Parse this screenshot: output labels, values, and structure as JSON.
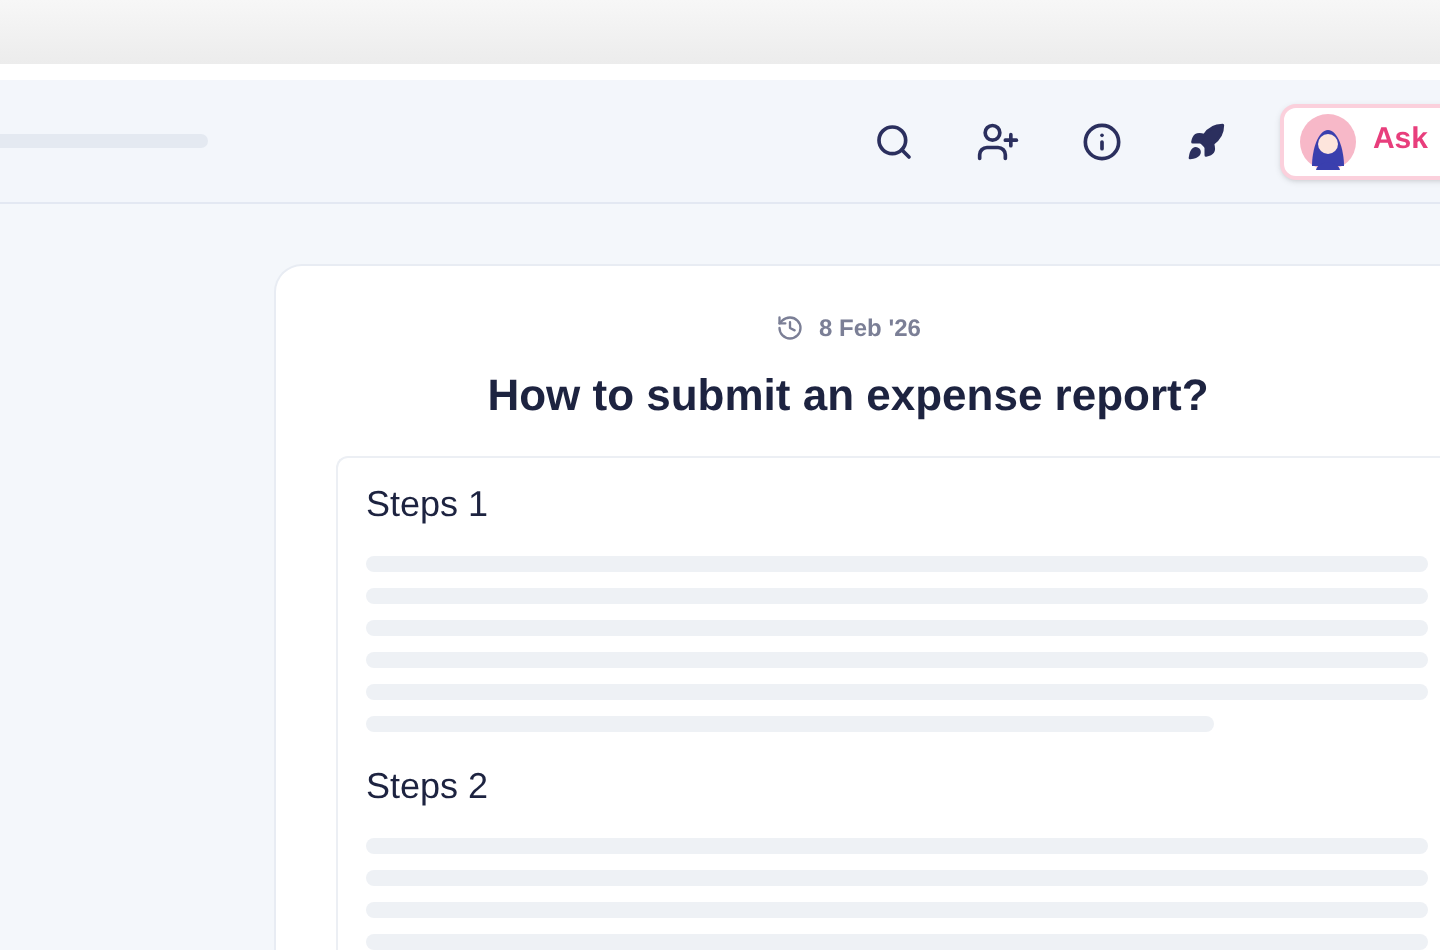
{
  "header": {
    "ask_button": {
      "label": "Ask"
    }
  },
  "article": {
    "date": "8 Feb '26",
    "title": "How to submit an expense report?",
    "sections": [
      {
        "heading": "Steps 1"
      },
      {
        "heading": "Steps 2"
      }
    ]
  }
}
